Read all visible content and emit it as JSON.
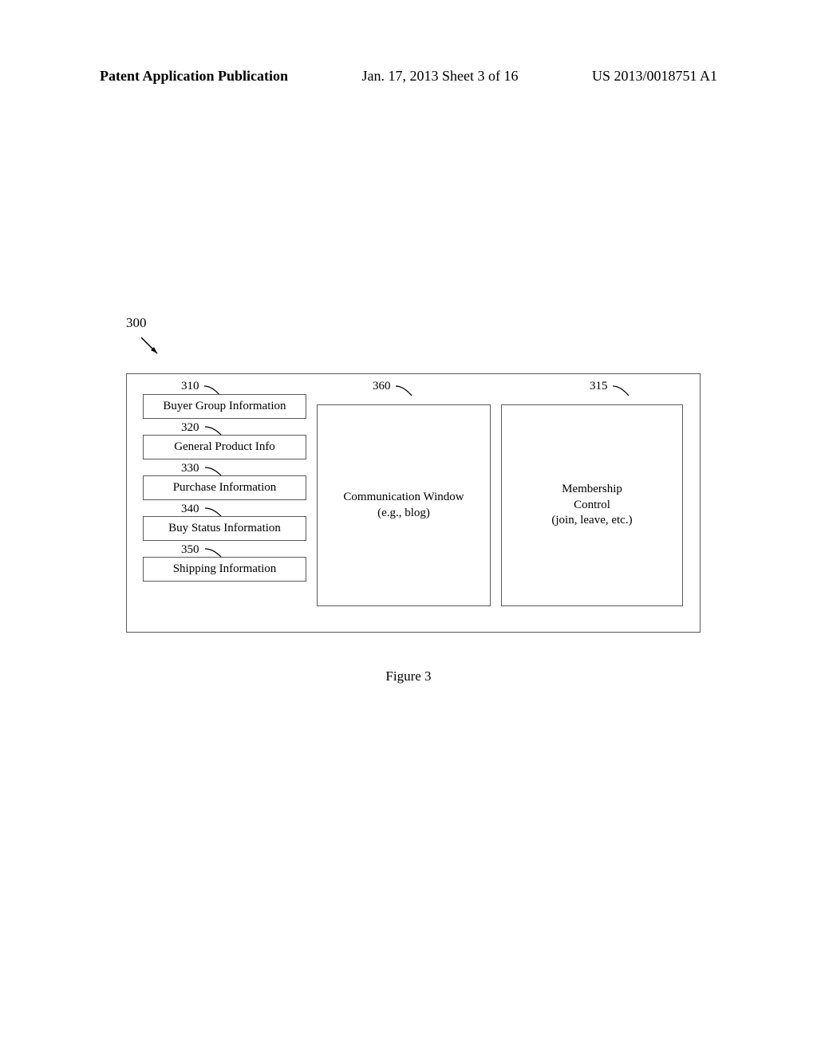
{
  "header": {
    "left": "Patent Application Publication",
    "center": "Jan. 17, 2013  Sheet 3 of 16",
    "right": "US 2013/0018751 A1"
  },
  "refs": {
    "r300": "300",
    "r310": "310",
    "r320": "320",
    "r330": "330",
    "r340": "340",
    "r350": "350",
    "r360": "360",
    "r315": "315"
  },
  "boxes": {
    "b310": "Buyer Group Information",
    "b320": "General Product Info",
    "b330": "Purchase Information",
    "b340": "Buy Status Information",
    "b350": "Shipping Information",
    "b360_line1": "Communication Window",
    "b360_line2": "(e.g., blog)",
    "b315_line1": "Membership",
    "b315_line2": "Control",
    "b315_line3": "(join, leave, etc.)"
  },
  "caption": "Figure 3"
}
